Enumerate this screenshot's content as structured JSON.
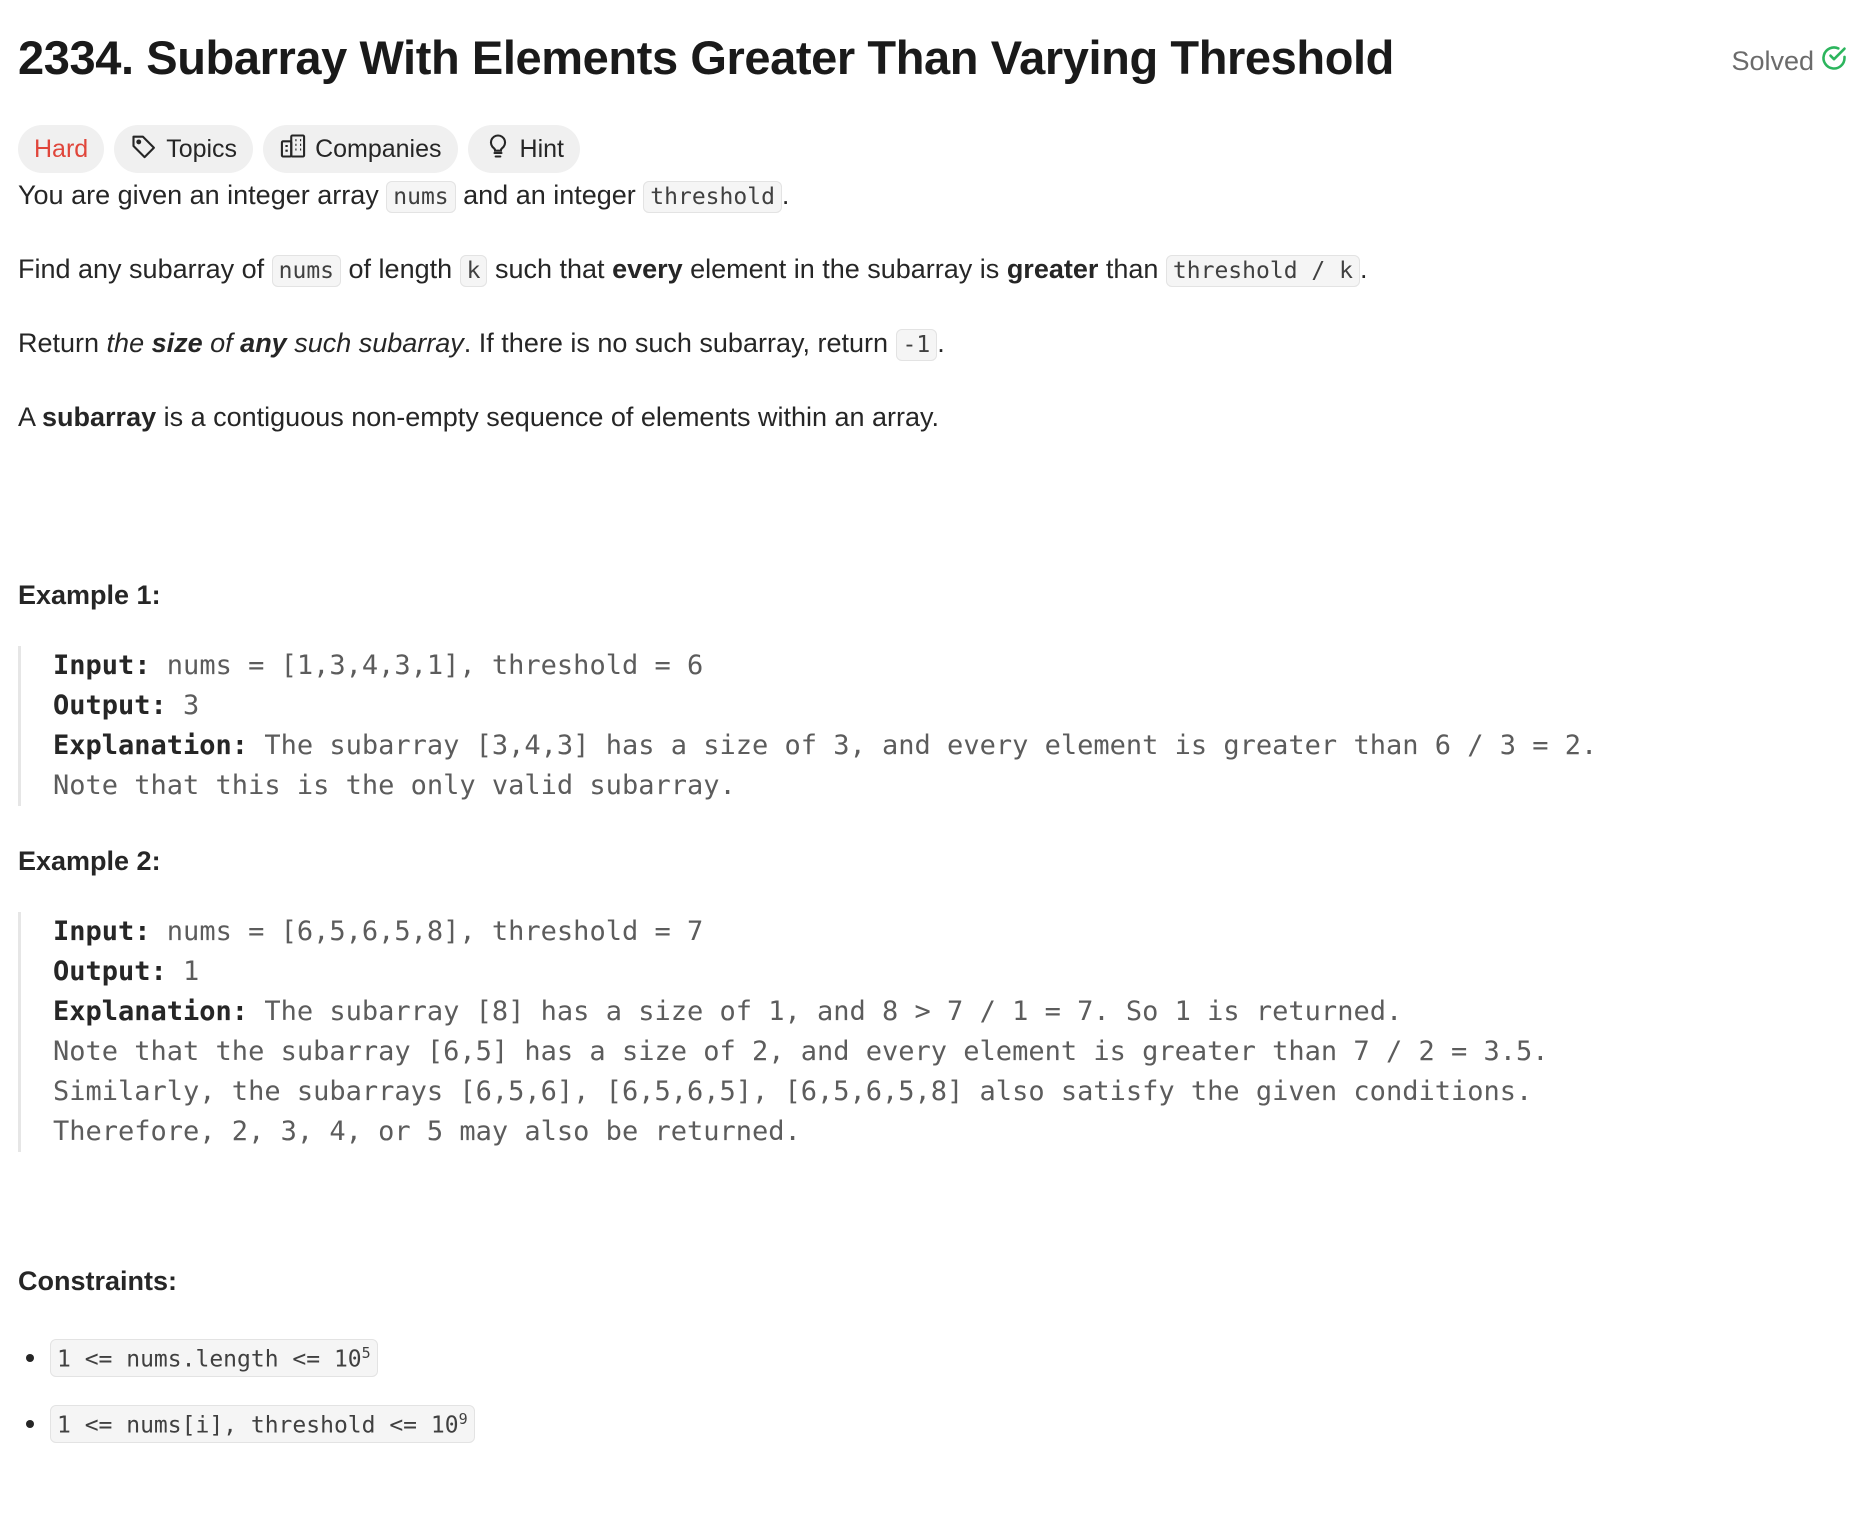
{
  "problem": {
    "title": "2334. Subarray With Elements Greater Than Varying Threshold",
    "status": "Solved",
    "difficulty": "Hard",
    "tags": [
      "Topics",
      "Companies",
      "Hint"
    ]
  },
  "description": {
    "p1": [
      "You are given an integer array ",
      "nums",
      " and an integer ",
      "threshold",
      "."
    ],
    "p2": [
      "Find any subarray of ",
      "nums",
      " of length ",
      "k",
      " such that ",
      "every",
      " element in the subarray is ",
      "greater",
      " than ",
      "threshold / k",
      "."
    ],
    "p3": [
      "Return ",
      "the ",
      "size",
      " of ",
      "any",
      " such subarray",
      ". If there is no such subarray, return ",
      "-1",
      "."
    ],
    "p4": [
      "A ",
      "subarray",
      " is a contiguous non-empty sequence of elements within an array."
    ]
  },
  "examples": [
    {
      "heading": "Example 1:",
      "input_label": "Input:",
      "input": " nums = [1,3,4,3,1], threshold = 6",
      "output_label": "Output:",
      "output": " 3",
      "explanation_label": "Explanation:",
      "explanation": " The subarray [3,4,3] has a size of 3, and every element is greater than 6 / 3 = 2.",
      "extra": [
        "Note that this is the only valid subarray."
      ]
    },
    {
      "heading": "Example 2:",
      "input_label": "Input:",
      "input": " nums = [6,5,6,5,8], threshold = 7",
      "output_label": "Output:",
      "output": " 1",
      "explanation_label": "Explanation:",
      "explanation": " The subarray [8] has a size of 1, and 8 > 7 / 1 = 7. So 1 is returned.",
      "extra": [
        "Note that the subarray [6,5] has a size of 2, and every element is greater than 7 / 2 = 3.5.",
        "Similarly, the subarrays [6,5,6], [6,5,6,5], [6,5,6,5,8] also satisfy the given conditions.",
        "Therefore, 2, 3, 4, or 5 may also be returned."
      ]
    }
  ],
  "constraints": {
    "heading": "Constraints:",
    "items": [
      {
        "text": "1 <= nums.length <= 10",
        "sup": "5"
      },
      {
        "text": "1 <= nums[i], threshold <= 10",
        "sup": "9"
      }
    ]
  },
  "colors": {
    "difficulty_hard": "#e0463b",
    "solved_check": "#2cb55d"
  }
}
